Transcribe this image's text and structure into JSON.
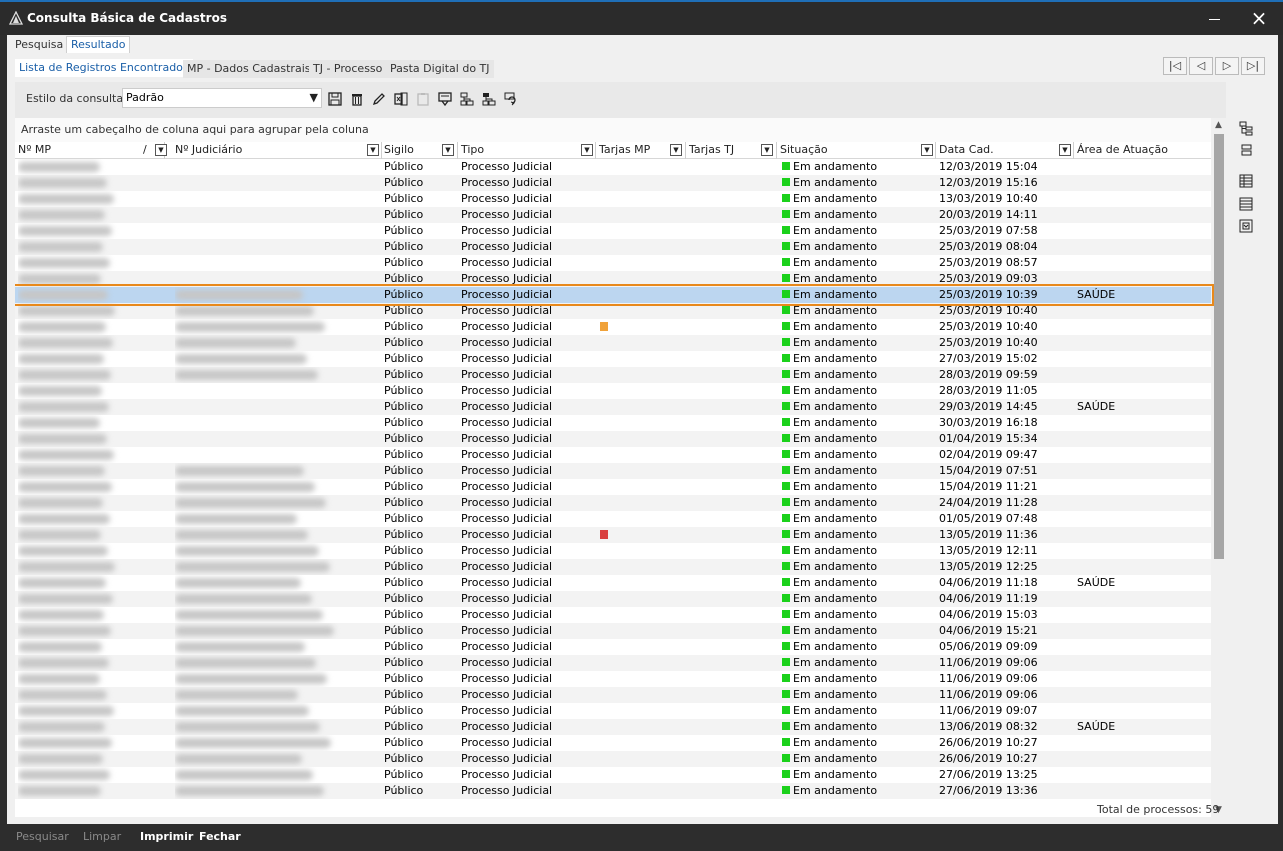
{
  "window": {
    "title": "Consulta Básica de Cadastros",
    "minimize_icon": "minimize-icon",
    "close_icon": "close-icon",
    "close_glyph": "×"
  },
  "top_tabs": [
    {
      "label": "Pesquisa"
    },
    {
      "label": "Resultado",
      "active": true
    }
  ],
  "sub_tabs": [
    {
      "label": "Lista de Registros Encontrados",
      "active": true
    },
    {
      "label": "MP - Dados Cadastrais"
    },
    {
      "label": "TJ - Processo"
    },
    {
      "label": "Pasta Digital do TJ"
    }
  ],
  "nav": {
    "first": "|◁",
    "prev": "◁",
    "next": "▷",
    "last": "▷|"
  },
  "style": {
    "label": "Estilo da consulta",
    "value": "Padrão"
  },
  "toolbar_icons": [
    "save-icon",
    "delete-icon",
    "edit-icon",
    "export-icon",
    "clipboard-icon",
    "filter-icon",
    "network-icon",
    "network-alt-icon",
    "refresh-icon"
  ],
  "grid": {
    "group_hint": "Arraste um cabeçalho de coluna aqui para agrupar pela coluna",
    "columns": {
      "mp": "Nº MP",
      "mp_sort": "/",
      "judiciario": "Nº Judiciário",
      "sigilo": "Sigilo",
      "tipo": "Tipo",
      "tarjas_mp": "Tarjas MP",
      "tarjas_tj": "Tarjas TJ",
      "situacao": "Situação",
      "data": "Data Cad.",
      "area": "Área de Atuação"
    },
    "sigilo_value": "Público",
    "tipo_value": "Processo Judicial",
    "situacao_value": "Em andamento",
    "colors": {
      "status": "#1bd11b",
      "tarja_orange": "#f0a23a",
      "tarja_red": "#d94040",
      "selection_outline": "#e8891c"
    },
    "rows": [
      {
        "data": "12/03/2019 15:04",
        "area": "",
        "jud": false,
        "tarja": ""
      },
      {
        "data": "12/03/2019 15:16",
        "area": "",
        "jud": false,
        "tarja": ""
      },
      {
        "data": "13/03/2019 10:40",
        "area": "",
        "jud": false,
        "tarja": ""
      },
      {
        "data": "20/03/2019 14:11",
        "area": "",
        "jud": false,
        "tarja": ""
      },
      {
        "data": "25/03/2019 07:58",
        "area": "",
        "jud": false,
        "tarja": ""
      },
      {
        "data": "25/03/2019 08:04",
        "area": "",
        "jud": false,
        "tarja": ""
      },
      {
        "data": "25/03/2019 08:57",
        "area": "",
        "jud": false,
        "tarja": ""
      },
      {
        "data": "25/03/2019 09:03",
        "area": "",
        "jud": false,
        "tarja": ""
      },
      {
        "data": "25/03/2019 10:39",
        "area": "SAÚDE",
        "jud": true,
        "tarja": "",
        "selected": true
      },
      {
        "data": "25/03/2019 10:40",
        "area": "",
        "jud": true,
        "tarja": ""
      },
      {
        "data": "25/03/2019 10:40",
        "area": "",
        "jud": true,
        "tarja": "orange"
      },
      {
        "data": "25/03/2019 10:40",
        "area": "",
        "jud": true,
        "tarja": ""
      },
      {
        "data": "27/03/2019 15:02",
        "area": "",
        "jud": true,
        "tarja": ""
      },
      {
        "data": "28/03/2019 09:59",
        "area": "",
        "jud": true,
        "tarja": ""
      },
      {
        "data": "28/03/2019 11:05",
        "area": "",
        "jud": false,
        "tarja": ""
      },
      {
        "data": "29/03/2019 14:45",
        "area": "SAÚDE",
        "jud": false,
        "tarja": ""
      },
      {
        "data": "30/03/2019 16:18",
        "area": "",
        "jud": false,
        "tarja": ""
      },
      {
        "data": "01/04/2019 15:34",
        "area": "",
        "jud": false,
        "tarja": ""
      },
      {
        "data": "02/04/2019 09:47",
        "area": "",
        "jud": false,
        "tarja": ""
      },
      {
        "data": "15/04/2019 07:51",
        "area": "",
        "jud": true,
        "tarja": ""
      },
      {
        "data": "15/04/2019 11:21",
        "area": "",
        "jud": true,
        "tarja": ""
      },
      {
        "data": "24/04/2019 11:28",
        "area": "",
        "jud": true,
        "tarja": ""
      },
      {
        "data": "01/05/2019 07:48",
        "area": "",
        "jud": true,
        "tarja": ""
      },
      {
        "data": "13/05/2019 11:36",
        "area": "",
        "jud": true,
        "tarja": "red"
      },
      {
        "data": "13/05/2019 12:11",
        "area": "",
        "jud": true,
        "tarja": ""
      },
      {
        "data": "13/05/2019 12:25",
        "area": "",
        "jud": true,
        "tarja": ""
      },
      {
        "data": "04/06/2019 11:18",
        "area": "SAÚDE",
        "jud": true,
        "tarja": ""
      },
      {
        "data": "04/06/2019 11:19",
        "area": "",
        "jud": true,
        "tarja": ""
      },
      {
        "data": "04/06/2019 15:03",
        "area": "",
        "jud": true,
        "tarja": ""
      },
      {
        "data": "04/06/2019 15:21",
        "area": "",
        "jud": true,
        "tarja": ""
      },
      {
        "data": "05/06/2019 09:09",
        "area": "",
        "jud": true,
        "tarja": ""
      },
      {
        "data": "11/06/2019 09:06",
        "area": "",
        "jud": true,
        "tarja": ""
      },
      {
        "data": "11/06/2019 09:06",
        "area": "",
        "jud": true,
        "tarja": ""
      },
      {
        "data": "11/06/2019 09:06",
        "area": "",
        "jud": true,
        "tarja": ""
      },
      {
        "data": "11/06/2019 09:07",
        "area": "",
        "jud": true,
        "tarja": ""
      },
      {
        "data": "13/06/2019 08:32",
        "area": "SAÚDE",
        "jud": true,
        "tarja": ""
      },
      {
        "data": "26/06/2019 10:27",
        "area": "",
        "jud": true,
        "tarja": ""
      },
      {
        "data": "26/06/2019 10:27",
        "area": "",
        "jud": true,
        "tarja": ""
      },
      {
        "data": "27/06/2019 13:25",
        "area": "",
        "jud": true,
        "tarja": ""
      },
      {
        "data": "27/06/2019 13:36",
        "area": "",
        "jud": true,
        "tarja": ""
      }
    ]
  },
  "total": "Total de processos: 59",
  "side_icons": [
    "tree-icon",
    "collapse-icon",
    "columns-icon",
    "list-icon",
    "summary-icon"
  ],
  "bottom": {
    "pesquisar": "Pesquisar",
    "limpar": "Limpar",
    "imprimir": "Imprimir",
    "fechar": "Fechar"
  }
}
